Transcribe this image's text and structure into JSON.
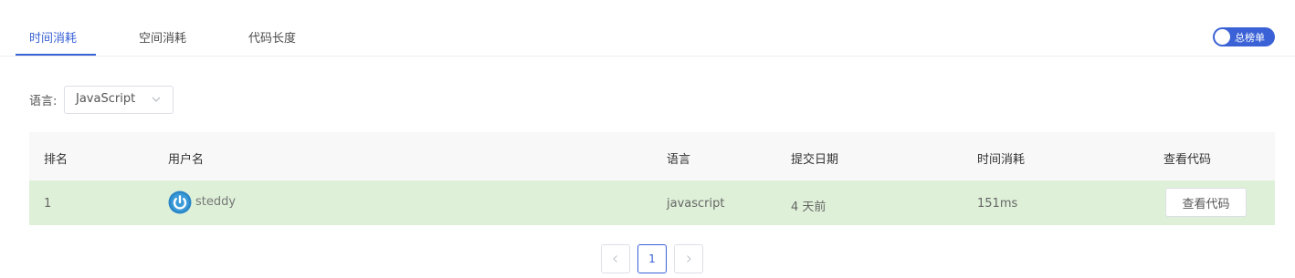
{
  "tabs": [
    {
      "label": "时间消耗"
    },
    {
      "label": "空间消耗"
    },
    {
      "label": "代码长度"
    }
  ],
  "toggle": {
    "label": "总榜单"
  },
  "filter": {
    "language_label": "语言:",
    "language_value": "JavaScript"
  },
  "table": {
    "headers": {
      "rank": "排名",
      "user": "用户名",
      "language": "语言",
      "date": "提交日期",
      "time": "时间消耗",
      "code": "查看代码"
    },
    "rows": [
      {
        "rank": "1",
        "user": "steddy",
        "language": "javascript",
        "date": "4 天前",
        "time": "151ms",
        "view_button": "查看代码"
      }
    ]
  },
  "pagination": {
    "current_page": "1"
  },
  "colors": {
    "accent": "#3a62d6",
    "row_highlight": "#def0d8",
    "header_bg": "#f8f8f8"
  }
}
